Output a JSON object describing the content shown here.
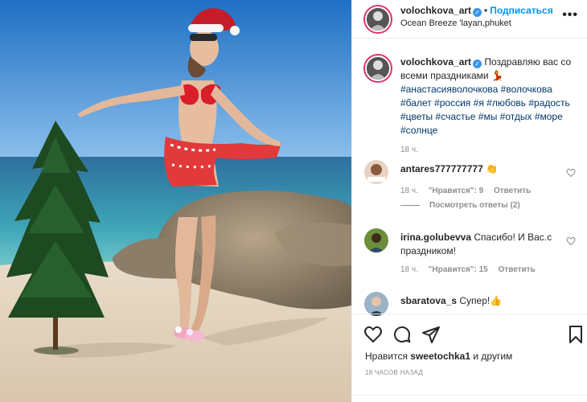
{
  "post": {
    "author": "volochkova_art",
    "follow_label": "Подписаться",
    "location": "Ocean Breeze 'layan,phuket",
    "caption_text": "Поздравляю вас со всеми праздниками",
    "caption_emoji": "💃",
    "hashtags": [
      "#анастасияволочкова",
      "#волочкова",
      "#балет",
      "#россия",
      "#я",
      "#любовь",
      "#радость",
      "#цветы",
      "#счастье",
      "#мы",
      "#отдых",
      "#море",
      "#солнце"
    ],
    "caption_time": "18 ч.",
    "more_label": "•••"
  },
  "comments": [
    {
      "user": "antares777777777",
      "text": "👏",
      "time": "18 ч.",
      "likes": "\"Нравится\": 9",
      "reply": "Ответить",
      "view_replies": "Посмотреть ответы (2)"
    },
    {
      "user": "irina.golubevva",
      "text": "Спасибо! И Вас.с праздником!",
      "time": "18 ч.",
      "likes": "\"Нравится\": 15",
      "reply": "Ответить"
    },
    {
      "user": "sbaratova_s",
      "text": "Супер!👍"
    }
  ],
  "footer": {
    "likes_prefix": "Нравится",
    "likes_user": "sweetochka1",
    "likes_suffix": "и другим",
    "posted_ago": "18 ЧАСОВ НАЗАД"
  },
  "icons": {
    "like": "heart-icon",
    "comment": "comment-icon",
    "share": "share-icon",
    "save": "bookmark-icon"
  },
  "colors": {
    "link": "#0095f6",
    "hashtag": "#00376b",
    "muted": "#8e8e8e",
    "verified": "#3897f0"
  }
}
